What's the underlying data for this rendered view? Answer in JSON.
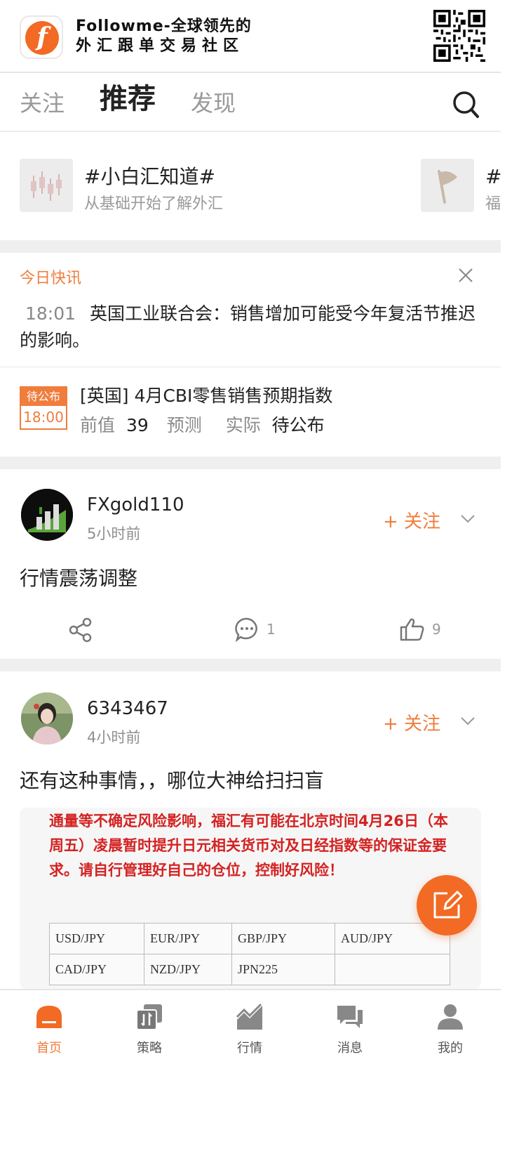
{
  "banner": {
    "line1": "Followme-全球领先的",
    "line2": "外汇跟单交易社区",
    "logo_letter": "f"
  },
  "tabs": [
    {
      "label": "关注",
      "active": false
    },
    {
      "label": "推荐",
      "active": true
    },
    {
      "label": "发现",
      "active": false
    }
  ],
  "topics": [
    {
      "title": "#小白汇知道#",
      "subtitle": "从基础开始了解外汇"
    },
    {
      "title": "#环",
      "subtitle": "福"
    }
  ],
  "news": {
    "header": "今日快讯",
    "time": "18:01",
    "text": "英国工业联合会：销售增加可能受今年复活节推迟的影响。",
    "event": {
      "badge_status": "待公布",
      "badge_time": "18:00",
      "title": "[英国] 4月CBI零售销售预期指数",
      "prev_label": "前值",
      "prev_value": "39",
      "forecast_label": "预测",
      "actual_label": "实际",
      "actual_value": "待公布"
    }
  },
  "posts": [
    {
      "username": "FXgold110",
      "time_ago": "5小时前",
      "follow_label": "+ 关注",
      "content": "行情震荡调整",
      "comments": "1",
      "likes": "9"
    },
    {
      "username": "6343467",
      "time_ago": "4小时前",
      "follow_label": "+ 关注",
      "content": "还有这种事情，，哪位大神给扫扫盲"
    }
  ],
  "notice": {
    "text": "通量等不确定风险影响，福汇有可能在北京时间4月26日（本周五）凌晨暂时提升日元相关货币对及日经指数等的保证金要求。请自行管理好自己的仓位，控制好风险！",
    "table": [
      [
        "USD/JPY",
        "EUR/JPY",
        "GBP/JPY",
        "AUD/JPY"
      ],
      [
        "CAD/JPY",
        "NZD/JPY",
        "JPN225",
        ""
      ]
    ]
  },
  "bottom_nav": [
    {
      "label": "首页",
      "icon": "home-icon",
      "active": true
    },
    {
      "label": "策略",
      "icon": "strategy-icon",
      "active": false
    },
    {
      "label": "行情",
      "icon": "market-icon",
      "active": false
    },
    {
      "label": "消息",
      "icon": "message-icon",
      "active": false
    },
    {
      "label": "我的",
      "icon": "profile-icon",
      "active": false
    }
  ],
  "colors": {
    "accent": "#f07d3c",
    "brand": "#f26a24",
    "notice_red": "#d42222"
  }
}
